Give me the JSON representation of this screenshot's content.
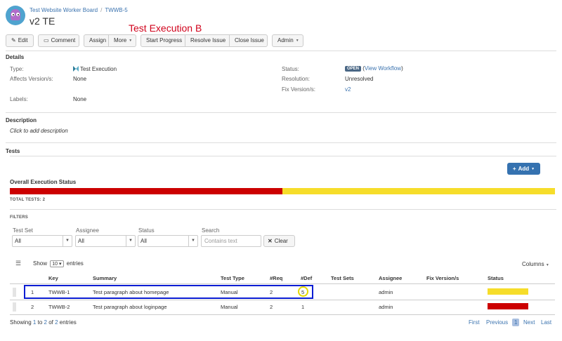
{
  "header": {
    "project": "Test Website Worker Board",
    "issue_key": "TWWB-5",
    "title": "v2 TE",
    "annotation": "Test Execution B"
  },
  "toolbar": {
    "edit": "Edit",
    "comment": "Comment",
    "assign": "Assign",
    "more": "More",
    "start_progress": "Start Progress",
    "resolve_issue": "Resolve Issue",
    "close_issue": "Close Issue",
    "admin": "Admin"
  },
  "details": {
    "heading": "Details",
    "type_label": "Type:",
    "type_value": "Test Execution",
    "affects_label": "Affects Version/s:",
    "affects_value": "None",
    "labels_label": "Labels:",
    "labels_value": "None",
    "status_label": "Status:",
    "status_value": "OPEN",
    "view_workflow": "View Workflow",
    "resolution_label": "Resolution:",
    "resolution_value": "Unresolved",
    "fix_label": "Fix Version/s:",
    "fix_value": "v2"
  },
  "description": {
    "heading": "Description",
    "placeholder": "Click to add description"
  },
  "tests": {
    "heading": "Tests",
    "add_button": "Add",
    "overall_heading": "Overall Execution Status",
    "progress": [
      {
        "status": "FAIL",
        "fraction": 0.5,
        "color": "#cc0000"
      },
      {
        "status": "TODO",
        "fraction": 0.5,
        "color": "#f6dd2a"
      }
    ],
    "total_tests": "TOTAL TESTS: 2"
  },
  "filters": {
    "heading": "FILTERS",
    "test_set_label": "Test Set",
    "test_set_value": "All",
    "assignee_label": "Assignee",
    "assignee_value": "All",
    "status_label": "Status",
    "status_value": "All",
    "search_label": "Search",
    "search_placeholder": "Contains text",
    "clear_button": "Clear"
  },
  "table": {
    "show_label": "Show",
    "page_size": "10",
    "entries_label": "entries",
    "columns_button": "Columns",
    "headers": [
      "Key",
      "Summary",
      "Test Type",
      "#Req",
      "#Def",
      "Test Sets",
      "Assignee",
      "Fix Version/s",
      "Status"
    ],
    "rows": [
      {
        "index": "1",
        "key": "TWWB-1",
        "summary": "Test paragraph about homepage",
        "test_type": "Manual",
        "req": "2",
        "def": "5",
        "test_sets": "",
        "assignee": "admin",
        "fix_versions": "",
        "status_color": "#f6dd2a"
      },
      {
        "index": "2",
        "key": "TWWB-2",
        "summary": "Test paragraph about loginpage",
        "test_type": "Manual",
        "req": "2",
        "def": "1",
        "test_sets": "",
        "assignee": "admin",
        "fix_versions": "",
        "status_color": "#cc0000"
      }
    ],
    "showing_prefix": "Showing",
    "showing_from": "1",
    "showing_to_word": "to",
    "showing_to": "2",
    "showing_of_word": "of",
    "showing_total": "2",
    "showing_suffix": "entries"
  },
  "pagination": {
    "first": "First",
    "previous": "Previous",
    "current": "1",
    "next": "Next",
    "last": "Last"
  }
}
